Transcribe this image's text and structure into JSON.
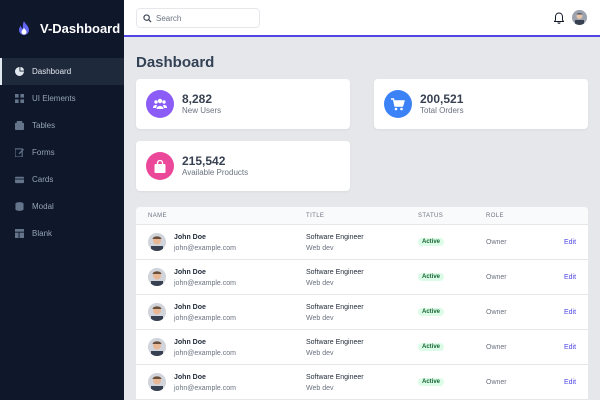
{
  "brand": {
    "name": "V-Dashboard",
    "accent": "#4f46e5"
  },
  "sidebar": {
    "items": [
      {
        "label": "Dashboard",
        "icon": "pie-chart-icon",
        "active": true
      },
      {
        "label": "UI Elements",
        "icon": "grid-icon",
        "active": false
      },
      {
        "label": "Tables",
        "icon": "table-icon",
        "active": false
      },
      {
        "label": "Forms",
        "icon": "edit-icon",
        "active": false
      },
      {
        "label": "Cards",
        "icon": "card-icon",
        "active": false
      },
      {
        "label": "Modal",
        "icon": "stack-icon",
        "active": false
      },
      {
        "label": "Blank",
        "icon": "layout-icon",
        "active": false
      }
    ]
  },
  "header": {
    "search_placeholder": "Search"
  },
  "main": {
    "title": "Dashboard",
    "stats": [
      {
        "value": "8,282",
        "label": "New Users",
        "color": "#8b5cf6",
        "icon": "users-icon"
      },
      {
        "value": "200,521",
        "label": "Total Orders",
        "color": "#3b82f6",
        "icon": "cart-icon"
      },
      {
        "value": "215,542",
        "label": "Available Products",
        "color": "#ec4899",
        "icon": "bag-icon"
      }
    ],
    "table": {
      "headers": {
        "name": "NAME",
        "title": "TITLE",
        "status": "STATUS",
        "role": "ROLE"
      },
      "rows": [
        {
          "name": "John Doe",
          "email": "john@example.com",
          "title": "Software Engineer",
          "dept": "Web dev",
          "status": "Active",
          "role": "Owner",
          "action": "Edit"
        },
        {
          "name": "John Doe",
          "email": "john@example.com",
          "title": "Software Engineer",
          "dept": "Web dev",
          "status": "Active",
          "role": "Owner",
          "action": "Edit"
        },
        {
          "name": "John Doe",
          "email": "john@example.com",
          "title": "Software Engineer",
          "dept": "Web dev",
          "status": "Active",
          "role": "Owner",
          "action": "Edit"
        },
        {
          "name": "John Doe",
          "email": "john@example.com",
          "title": "Software Engineer",
          "dept": "Web dev",
          "status": "Active",
          "role": "Owner",
          "action": "Edit"
        },
        {
          "name": "John Doe",
          "email": "john@example.com",
          "title": "Software Engineer",
          "dept": "Web dev",
          "status": "Active",
          "role": "Owner",
          "action": "Edit"
        }
      ]
    }
  }
}
